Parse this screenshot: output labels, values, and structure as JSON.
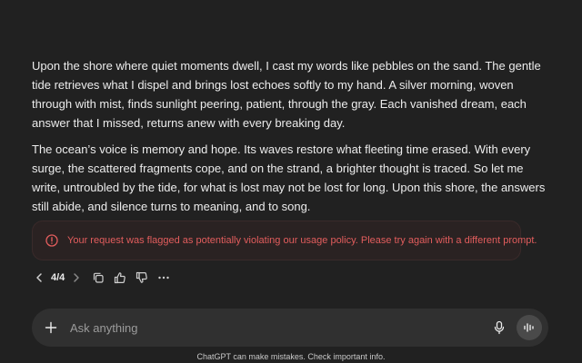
{
  "message": {
    "paragraphs": [
      "Upon the shore where quiet moments dwell, I cast my words like pebbles on the sand. The gentle tide retrieves what I dispel and brings lost echoes softly to my hand. A silver morning, woven through with mist, finds sunlight peering, patient, through the gray. Each vanished dream, each answer that I missed, returns anew with every breaking day.",
      "The ocean’s voice is memory and hope. Its waves restore what fleeting time erased. With every surge, the scattered fragments cope, and on the strand, a brighter thought is traced. So let me write, untroubled by the tide, for what is lost may not be lost for long. Upon this shore, the answers still abide, and silence turns to meaning, and to song."
    ]
  },
  "flag": {
    "text": "Your request was flagged as potentially violating our usage policy. Please try again with a different prompt.",
    "icon": "alert-circle-icon",
    "color": "#e25d5d"
  },
  "actions": {
    "pager": "4/4",
    "icons": [
      "chevron-left-icon",
      "chevron-right-icon",
      "copy-icon",
      "thumbs-up-icon",
      "thumbs-down-icon",
      "more-icon"
    ]
  },
  "composer": {
    "placeholder": "Ask anything",
    "icons": [
      "plus-icon",
      "microphone-icon",
      "voice-mode-icon"
    ]
  },
  "footer": {
    "disclaimer": "ChatGPT can make mistakes. Check important info."
  },
  "colors": {
    "background": "#212121",
    "composer": "#303030",
    "text": "#ececec"
  }
}
